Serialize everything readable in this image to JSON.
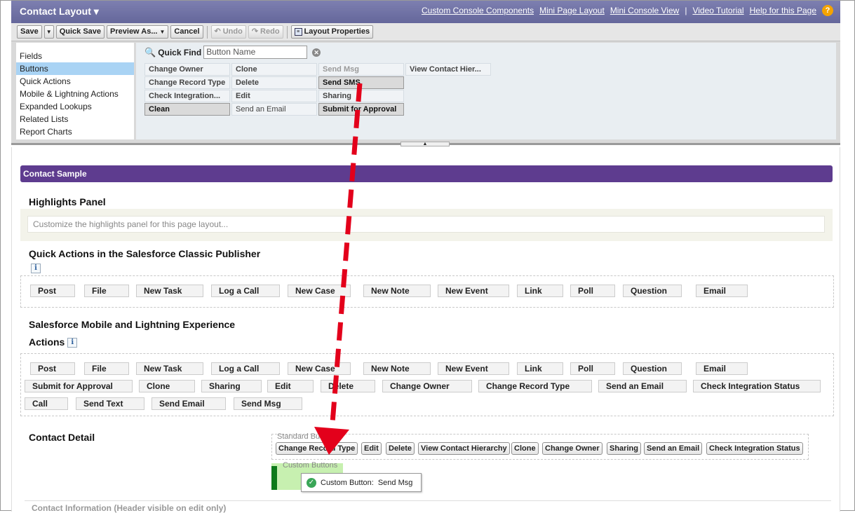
{
  "header": {
    "title": "Contact Layout",
    "links": [
      "Custom Console Components",
      "Mini Page Layout",
      "Mini Console View",
      "Video Tutorial",
      "Help for this Page"
    ],
    "separator": "|",
    "help_badge": "?"
  },
  "toolbar": {
    "save": "Save",
    "quick_save": "Quick Save",
    "preview_as": "Preview As...",
    "cancel": "Cancel",
    "undo": "Undo",
    "redo": "Redo",
    "layout_properties": "Layout Properties"
  },
  "palette": {
    "categories": [
      "Fields",
      "Buttons",
      "Quick Actions",
      "Mobile & Lightning Actions",
      "Expanded Lookups",
      "Related Lists",
      "Report Charts"
    ],
    "active_category": "Buttons",
    "quick_find_label": "Quick Find",
    "quick_find_placeholder": "Button Name",
    "items": [
      {
        "label": "Change Owner",
        "state": "normal"
      },
      {
        "label": "Change Record Type",
        "state": "normal"
      },
      {
        "label": "Check Integration...",
        "state": "normal"
      },
      {
        "label": "Clean",
        "state": "selected"
      },
      {
        "label": "Clone",
        "state": "normal"
      },
      {
        "label": "Delete",
        "state": "normal"
      },
      {
        "label": "Edit",
        "state": "normal"
      },
      {
        "label": "Send an Email",
        "state": "normal"
      },
      {
        "label": "Send Msg",
        "state": "used"
      },
      {
        "label": "Send SMS",
        "state": "selected"
      },
      {
        "label": "Sharing",
        "state": "normal"
      },
      {
        "label": "Submit for Approval",
        "state": "selected"
      },
      {
        "label": "View Contact Hier...",
        "state": "normal"
      }
    ]
  },
  "canvas": {
    "sample_title": "Contact Sample",
    "highlights": {
      "title": "Highlights Panel",
      "placeholder": "Customize the highlights panel for this page layout..."
    },
    "classic_publisher": {
      "title": "Quick Actions in the Salesforce Classic Publisher",
      "actions": [
        "Post",
        "File",
        "New Task",
        "Log a Call",
        "New Case",
        "New Note",
        "New Event",
        "Link",
        "Poll",
        "Question",
        "Email"
      ]
    },
    "mobile_actions": {
      "title_line1": "Salesforce Mobile and Lightning Experience",
      "title_line2": "Actions",
      "row1": [
        "Post",
        "File",
        "New Task",
        "Log a Call",
        "New Case",
        "New Note",
        "New Event",
        "Link",
        "Poll",
        "Question",
        "Email"
      ],
      "row2": [
        "Submit for Approval",
        "Clone",
        "Sharing",
        "Edit",
        "Delete",
        "Change Owner",
        "Change Record Type",
        "Send an Email",
        "Check Integration Status"
      ],
      "row3": [
        "Call",
        "Send Text",
        "Send Email",
        "Send Msg"
      ]
    },
    "contact_detail": {
      "title": "Contact Detail",
      "standard_label": "Standard Buttons",
      "standard_buttons": [
        "Change Record Type",
        "Edit",
        "Delete",
        "View Contact Hierarchy",
        "Clone",
        "Change Owner",
        "Sharing",
        "Send an Email",
        "Check Integration Status"
      ],
      "custom_label": "Custom Buttons",
      "drag_chip_prefix": "Custom Button:",
      "drag_chip_name": "Send Msg"
    },
    "contact_information": "Contact Information (Header visible on edit only)"
  },
  "colors": {
    "header_bg": "#6f71a6",
    "sample_bar": "#5e3c8f",
    "selected_category": "#a9d3f4",
    "arrow": "#e3001b",
    "drop_zone": "#c7f0b0"
  }
}
